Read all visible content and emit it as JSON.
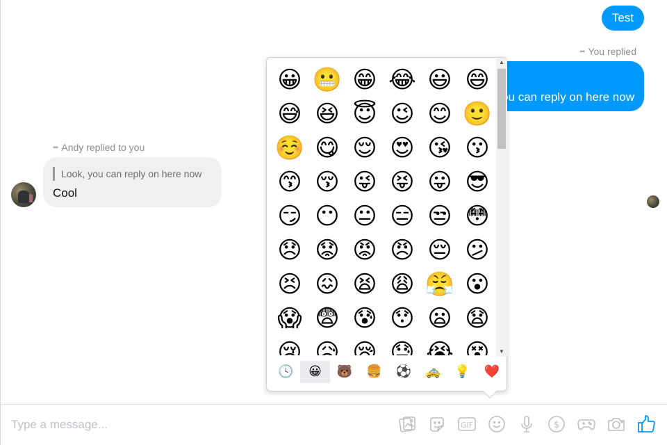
{
  "conversation": {
    "messages": [
      {
        "direction": "outgoing",
        "text": "Test"
      },
      {
        "direction": "outgoing",
        "meta": "You replied",
        "text": "Look, you can reply on here now",
        "visible_text": "u can reply on here now"
      },
      {
        "direction": "incoming",
        "meta": "Andy replied to you",
        "quoted": "Look, you can reply on here now",
        "text": "Cool",
        "sender": "Andy"
      }
    ]
  },
  "emoji_picker": {
    "emojis": [
      "😀",
      "😬",
      "😁",
      "😂",
      "😃",
      "😄",
      "😅",
      "😆",
      "😇",
      "😉",
      "😊",
      "🙂",
      "☺️",
      "😋",
      "😌",
      "😍",
      "😘",
      "😗",
      "😙",
      "😚",
      "😜",
      "😝",
      "😛",
      "😎",
      "😏",
      "😶",
      "😐",
      "😑",
      "😒",
      "😳",
      "😞",
      "😟",
      "😡",
      "😠",
      "😔",
      "😕",
      "😣",
      "😖",
      "😫",
      "😩",
      "😤",
      "😮",
      "😱",
      "😨",
      "😰",
      "😯",
      "😦",
      "😧",
      "😢",
      "😥",
      "😪",
      "😓",
      "😭",
      "😵"
    ],
    "categories": [
      {
        "name": "recent",
        "glyph": "🕓",
        "active": false
      },
      {
        "name": "people",
        "glyph": "😀",
        "active": true
      },
      {
        "name": "nature",
        "glyph": "🐻",
        "active": false
      },
      {
        "name": "food",
        "glyph": "🍔",
        "active": false
      },
      {
        "name": "activity",
        "glyph": "⚽",
        "active": false
      },
      {
        "name": "travel",
        "glyph": "🚕",
        "active": false
      },
      {
        "name": "objects",
        "glyph": "💡",
        "active": false
      },
      {
        "name": "symbols",
        "glyph": "❤️",
        "active": false
      }
    ]
  },
  "composer": {
    "placeholder": "Type a message...",
    "value": "",
    "tools": [
      "images-icon",
      "sticker-icon",
      "gif-icon",
      "emoji-icon",
      "microphone-icon",
      "payment-icon",
      "games-icon",
      "camera-icon",
      "thumbs-up-icon"
    ]
  },
  "colors": {
    "accent": "#0099ff",
    "incoming_bubble": "#f1f0f0",
    "icon_gray": "#bcc0c4"
  }
}
